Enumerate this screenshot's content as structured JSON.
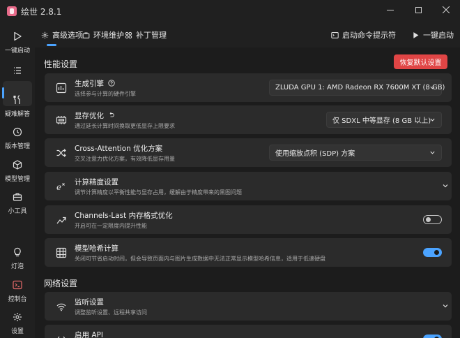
{
  "window": {
    "title": "绘世 2.8.1"
  },
  "sidebar": {
    "items": [
      {
        "label": "一键启动",
        "icon": "play-icon"
      },
      {
        "label": "",
        "icon": "list-icon",
        "active": true
      },
      {
        "label": "疑难解答",
        "icon": "wrench-icon"
      },
      {
        "label": "版本管理",
        "icon": "history-icon"
      },
      {
        "label": "模型管理",
        "icon": "cube-icon"
      },
      {
        "label": "小工具",
        "icon": "toolbox-icon"
      },
      {
        "label": "灯泡",
        "icon": "lightbulb-icon"
      },
      {
        "label": "控制台",
        "icon": "console-icon"
      },
      {
        "label": "设置",
        "icon": "gear-icon"
      }
    ]
  },
  "tabs": {
    "items": [
      {
        "label": "高级选项",
        "icon": "settings-tab-icon"
      },
      {
        "label": "环境维护",
        "icon": "env-tab-icon"
      },
      {
        "label": "补丁管理",
        "icon": "patch-tab-icon"
      }
    ],
    "launch_prompt": "启动命令提示符",
    "launch": "一键启动"
  },
  "performance": {
    "title": "性能设置",
    "reset_label": "恢复默认设置",
    "engine": {
      "title": "生成引擎",
      "desc": "选择参与计算的硬件引擎",
      "value": "ZLUDA GPU 1: AMD Radeon RX 7600M XT (8 GB)"
    },
    "vram": {
      "title": "显存优化",
      "desc": "通过延长计算时间换取更低显存上限要求",
      "value": "仅 SDXL 中等显存 (8 GB 以上)"
    },
    "attention": {
      "title": "Cross-Attention 优化方案",
      "desc": "交叉注意力优化方案，有效降低显存用量",
      "value": "使用缩放点积 (SDP) 方案"
    },
    "precision": {
      "title": "计算精度设置",
      "desc": "调节计算精度以平衡性能与显存占用，缓解由于精度带来的黑图问题"
    },
    "channels_last": {
      "title": "Channels-Last 内存格式优化",
      "desc": "开启可在一定限度内提升性能",
      "enabled": false
    },
    "model_hash": {
      "title": "模型哈希计算",
      "desc": "关闭可节省启动时间，但会导致页面内与图片生成数据中无法正常显示模型哈希信息，适用于低速硬盘",
      "enabled": true
    }
  },
  "network": {
    "title": "网络设置",
    "listen": {
      "title": "监听设置",
      "desc": "调整监听设置、远程共享访问"
    },
    "api": {
      "title": "启用 API"
    }
  },
  "colors": {
    "accent": "#4ba3ff",
    "danger": "#e04545",
    "card": "#2b2b2b",
    "background": "#1c1c1c"
  }
}
